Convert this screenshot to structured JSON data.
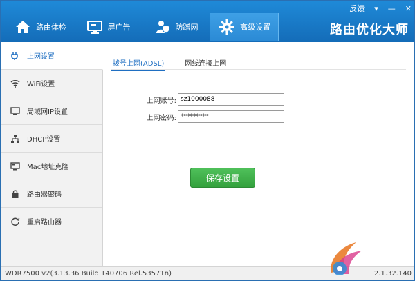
{
  "window_controls": {
    "feedback": "反馈",
    "dropdown": "▾",
    "minimize": "—",
    "close": "✕"
  },
  "tabs": [
    {
      "label": "路由体检",
      "icon": "home-icon"
    },
    {
      "label": "屏广告",
      "icon": "monitor-icon"
    },
    {
      "label": "防蹭网",
      "icon": "user-shield-icon"
    },
    {
      "label": "高级设置",
      "icon": "gear-icon"
    }
  ],
  "brand": "路由优化大师",
  "sidebar": {
    "items": [
      {
        "label": "上网设置",
        "icon": "plug-icon"
      },
      {
        "label": "WiFi设置",
        "icon": "wifi-icon"
      },
      {
        "label": "局域网IP设置",
        "icon": "monitor-icon"
      },
      {
        "label": "DHCP设置",
        "icon": "network-icon"
      },
      {
        "label": "Mac地址克隆",
        "icon": "monitor-icon"
      },
      {
        "label": "路由器密码",
        "icon": "lock-icon"
      },
      {
        "label": "重启路由器",
        "icon": "refresh-icon"
      }
    ]
  },
  "main": {
    "subtabs": [
      {
        "label": "拨号上网(ADSL)"
      },
      {
        "label": "网线连接上网"
      }
    ],
    "form": {
      "account_label": "上网账号:",
      "account_value": "sz1000088",
      "password_label": "上网密码:",
      "password_value": "*********"
    },
    "save_label": "保存设置"
  },
  "status": {
    "version": "WDR7500 v2(3.13.36 Build 140706 Rel.53571n)",
    "app_version": "2.1.32.140"
  },
  "colors": {
    "header": "#1a7dcc",
    "accent": "#1f6fc2",
    "save": "#3fae48"
  }
}
